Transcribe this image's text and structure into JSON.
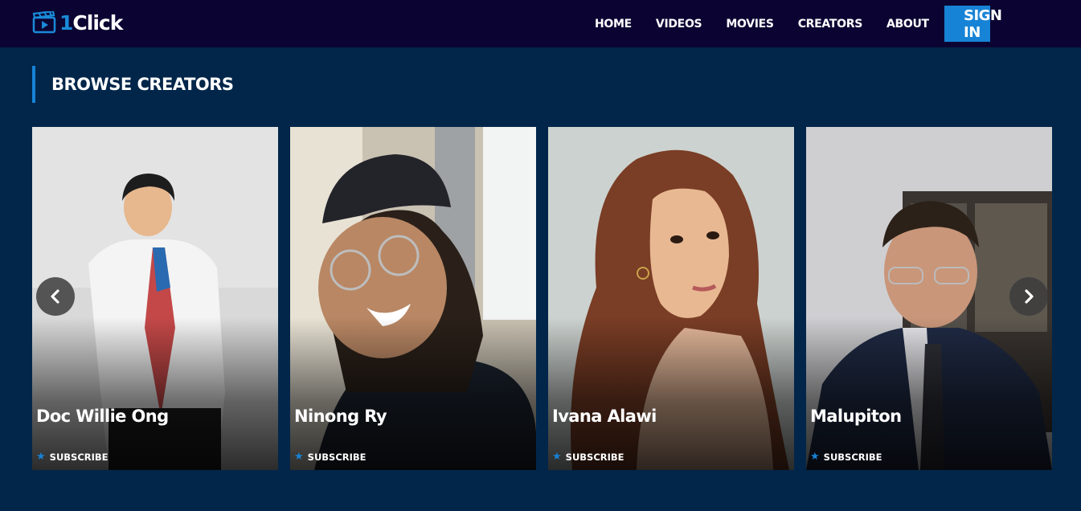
{
  "brand": {
    "logo_prefix": "1",
    "logo_suffix": "Click",
    "accent": "#1783d6",
    "logo_icon": "film-clapper-icon"
  },
  "nav": {
    "items": [
      "HOME",
      "VIDEOS",
      "MOVIES",
      "CREATORS",
      "ABOUT"
    ],
    "signin_label": "SIGN IN"
  },
  "section": {
    "title": "BROWSE CREATORS"
  },
  "creators": [
    {
      "name": "Doc Willie Ong",
      "subscribe_label": "SUBSCRIBE",
      "subscribe_icon": "star-icon"
    },
    {
      "name": "Ninong Ry",
      "subscribe_label": "SUBSCRIBE",
      "subscribe_icon": "star-icon"
    },
    {
      "name": "Ivana Alawi",
      "subscribe_label": "SUBSCRIBE",
      "subscribe_icon": "star-icon"
    },
    {
      "name": "Malupiton",
      "subscribe_label": "SUBSCRIBE",
      "subscribe_icon": "star-icon"
    }
  ],
  "carousel": {
    "prev_icon": "chevron-left-icon",
    "next_icon": "chevron-right-icon"
  }
}
